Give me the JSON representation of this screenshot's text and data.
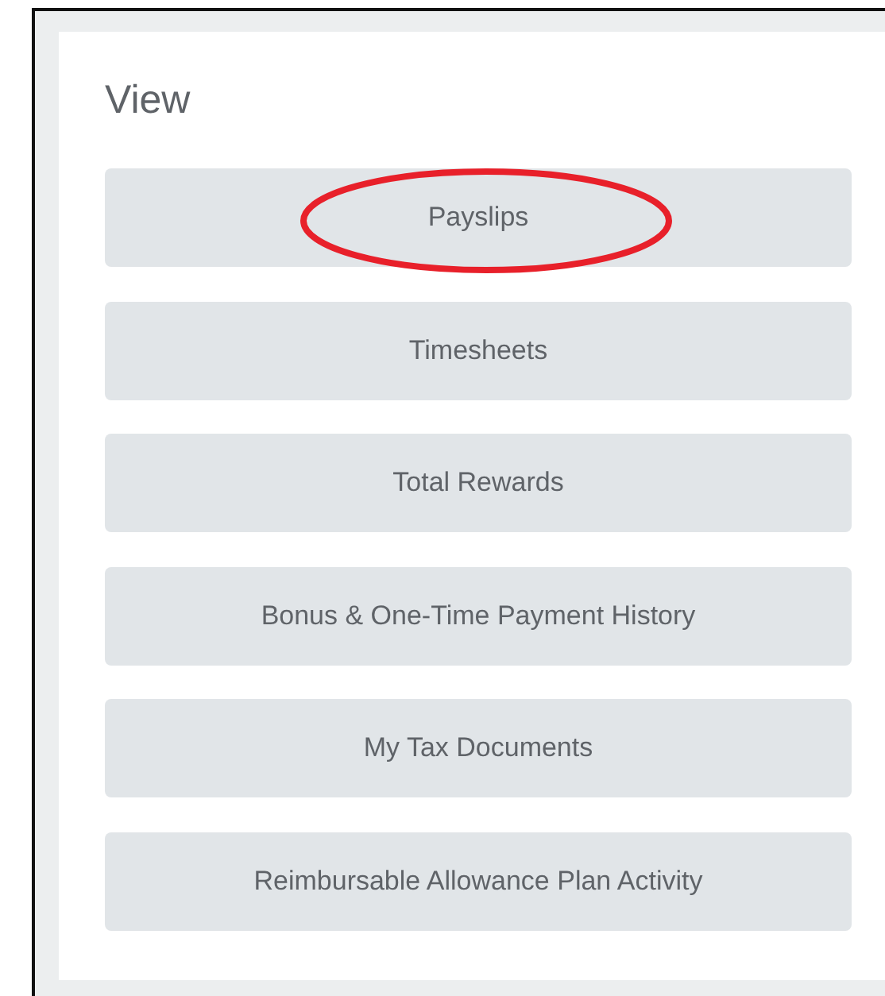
{
  "title": "View",
  "items": [
    {
      "label": "Payslips",
      "circled": true
    },
    {
      "label": "Timesheets",
      "circled": false
    },
    {
      "label": "Total Rewards",
      "circled": false
    },
    {
      "label": "Bonus & One-Time Payment History",
      "circled": false
    },
    {
      "label": "My Tax Documents",
      "circled": false
    },
    {
      "label": "Reimbursable Allowance Plan Activity",
      "circled": false
    }
  ]
}
